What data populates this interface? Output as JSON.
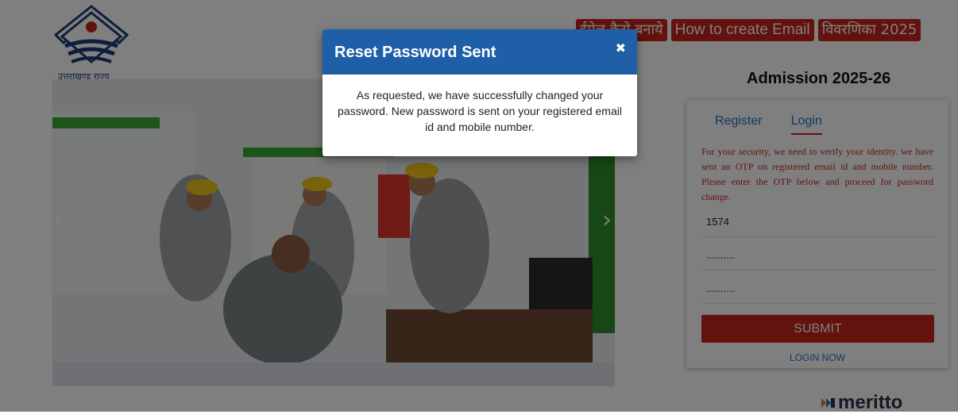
{
  "header": {
    "logo_text": "उत्तराखण्ड राज्य",
    "buttons": [
      "ईमेल कैसे बनाये",
      "How to create Email",
      "विवरणिका 2025"
    ]
  },
  "admission_title": "Admission 2025-26",
  "carousel": {
    "prev_icon": "‹",
    "next_icon": "›"
  },
  "form": {
    "tabs": [
      "Register",
      "Login"
    ],
    "active_tab": "Login",
    "message": "For your security, we need to verify your identity. we have sent an OTP on registered email id and mobile number. Please enter the OTP below and proceed for password change.",
    "otp_value": "1574",
    "password_mask": "..........",
    "confirm_mask": "..........",
    "submit_label": "SUBMIT",
    "login_now": "LOGIN NOW"
  },
  "brand": {
    "name": "meritto"
  },
  "modal": {
    "title": "Reset Password Sent",
    "close_icon": "✖",
    "body": "As requested, we have successfully changed your password. New password is sent on your registered email id and mobile number."
  },
  "colors": {
    "brand_red": "#c6251a",
    "modal_blue": "#1f5fa8",
    "link_blue": "#2a6fb8"
  }
}
